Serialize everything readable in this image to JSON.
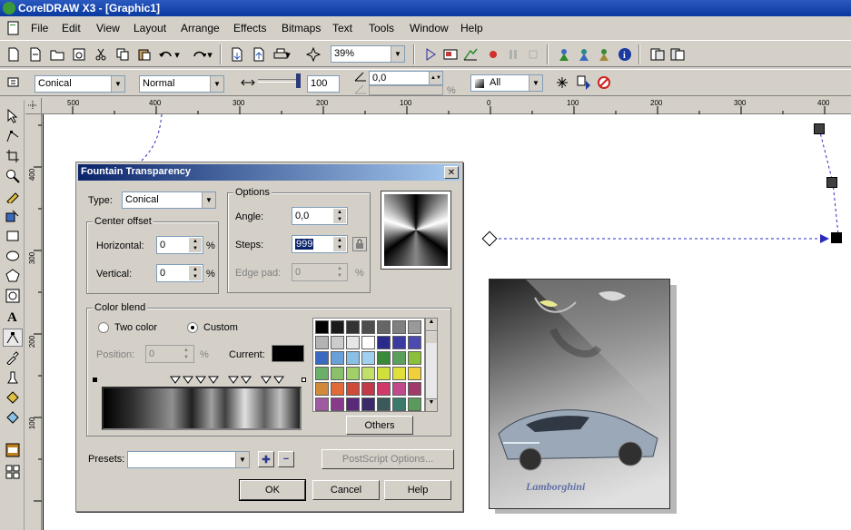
{
  "app": {
    "title": "CorelDRAW X3 - [Graphic1]"
  },
  "menu": [
    "File",
    "Edit",
    "View",
    "Layout",
    "Arrange",
    "Effects",
    "Bitmaps",
    "Text",
    "Tools",
    "Window",
    "Help"
  ],
  "toolbar": {
    "zoom": "39%"
  },
  "propbar": {
    "type": "Conical",
    "mode": "Normal",
    "value": "100",
    "angle": "0,0",
    "angle_unit": "%",
    "target": "All"
  },
  "ruler": {
    "h_labels": [
      "500",
      "400",
      "300",
      "200",
      "100",
      "0",
      "100",
      "200",
      "300",
      "400"
    ],
    "v_labels": [
      "400",
      "300",
      "200",
      "100"
    ]
  },
  "dialog": {
    "title": "Fountain Transparency",
    "type_label": "Type:",
    "type_value": "Conical",
    "center_offset": "Center offset",
    "horizontal_label": "Horizontal:",
    "horizontal_value": "0",
    "vertical_label": "Vertical:",
    "vertical_value": "0",
    "pct": "%",
    "options": "Options",
    "angle_label": "Angle:",
    "angle_value": "0,0",
    "steps_label": "Steps:",
    "steps_value": "999",
    "edgepad_label": "Edge pad:",
    "edgepad_value": "0",
    "color_blend": "Color blend",
    "two_color": "Two color",
    "custom": "Custom",
    "position_label": "Position:",
    "position_value": "0",
    "current_label": "Current:",
    "others": "Others",
    "presets_label": "Presets:",
    "postscript": "PostScript Options...",
    "ok": "OK",
    "cancel": "Cancel",
    "help": "Help"
  },
  "palette": [
    "#000000",
    "#1a1a1a",
    "#333333",
    "#4d4d4d",
    "#666666",
    "#808080",
    "#999999",
    "#b3b3b3",
    "#cccccc",
    "#e6e6e6",
    "#ffffff",
    "#2a2a8a",
    "#3a3aa0",
    "#4a4ab0",
    "#3a6ac0",
    "#6aa0d8",
    "#8ac0e8",
    "#a0d0f0",
    "#3a8a3a",
    "#5aa05a",
    "#8ac03a",
    "#6ab06a",
    "#8ac06a",
    "#a0d06a",
    "#c0e06a",
    "#d0e03a",
    "#e0e03a",
    "#f0d03a",
    "#d08a3a",
    "#e06a3a",
    "#d04a3a",
    "#c03a4a",
    "#d03a6a",
    "#c04a8a",
    "#a03a6a",
    "#a05aa0",
    "#8a3a8a",
    "#5a2a7a",
    "#3a2a6a",
    "#3a5a5a",
    "#3a7a6a",
    "#5a9a5a"
  ],
  "artwork": {
    "brand": "Lamborghini"
  }
}
